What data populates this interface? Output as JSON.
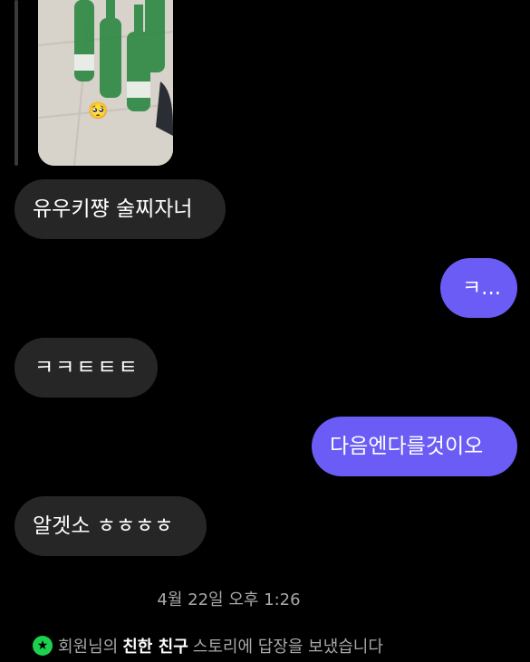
{
  "conversation": {
    "messages": [
      {
        "direction": "incoming",
        "text": "유우키쨩 술찌자너"
      },
      {
        "direction": "outgoing",
        "text": "ㅋ..."
      },
      {
        "direction": "incoming",
        "text": "ㅋㅋㅌㅌㅌ"
      },
      {
        "direction": "outgoing",
        "text": "다음엔다를것이오"
      },
      {
        "direction": "incoming",
        "text": "알겟소 ㅎㅎㅎㅎ"
      }
    ],
    "timestamp": "4월 22일 오후 1:26",
    "notice": {
      "prefix": "회원님의",
      "emphasis": "친한 친구",
      "suffix": "스토리에 답장을 보냈습니다",
      "badge_icon": "star-icon"
    }
  },
  "story_reply": {
    "emoji": "🥺"
  },
  "colors": {
    "background": "#000000",
    "incoming_bubble": "#262626",
    "outgoing_bubble": "#6b5cf5",
    "close_friends_badge": "#1cd14f",
    "muted_text": "#a8a8a8"
  }
}
